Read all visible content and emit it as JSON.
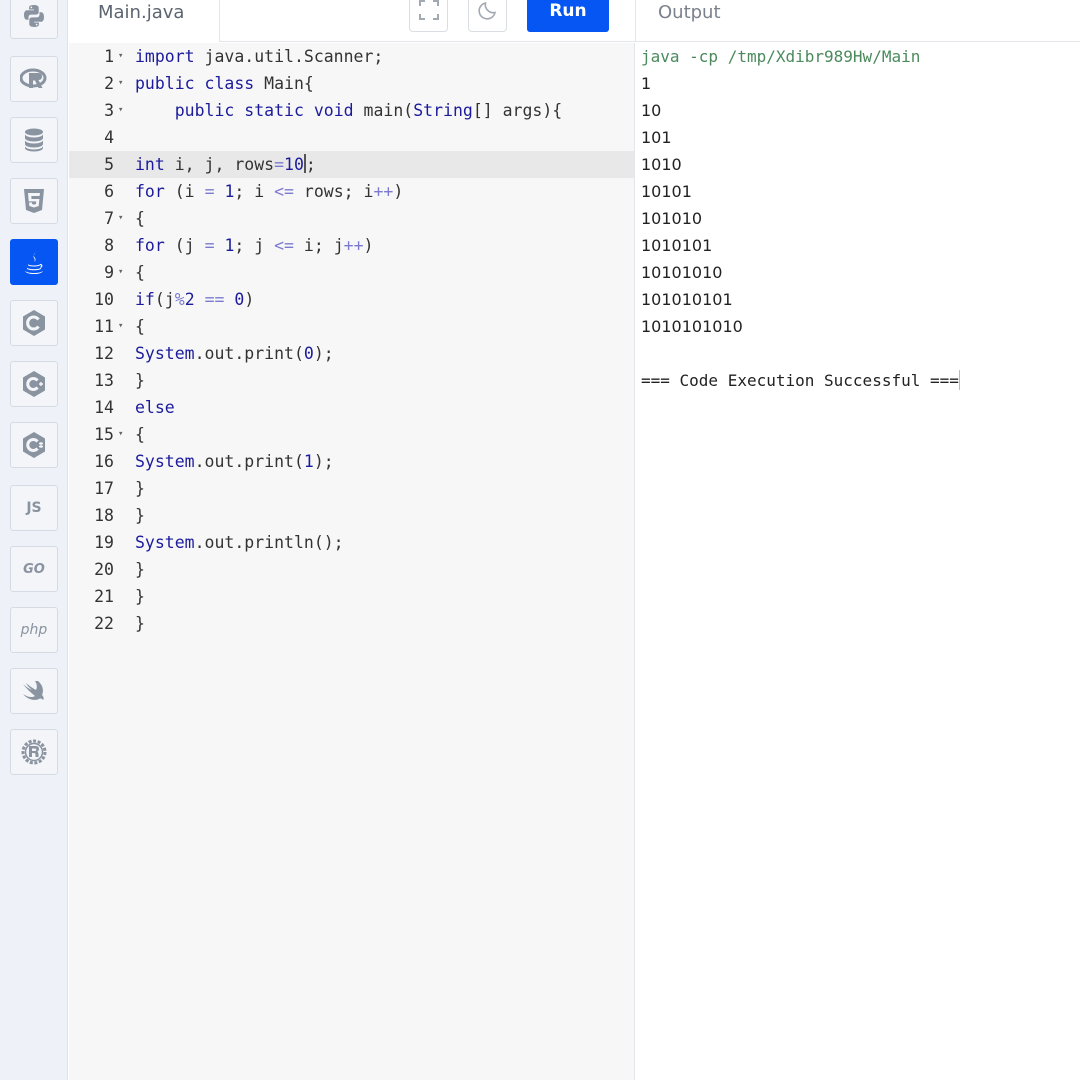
{
  "sidebar": {
    "languages": [
      {
        "name": "python",
        "icon": "python-icon",
        "active": false
      },
      {
        "name": "r",
        "icon": "r-icon",
        "active": false
      },
      {
        "name": "sql",
        "icon": "database-icon",
        "active": false
      },
      {
        "name": "html",
        "icon": "html5-icon",
        "active": false
      },
      {
        "name": "java",
        "icon": "java-icon",
        "active": true
      },
      {
        "name": "c",
        "icon": "c-icon",
        "active": false
      },
      {
        "name": "cpp",
        "icon": "cpp-icon",
        "active": false
      },
      {
        "name": "csharp",
        "icon": "csharp-icon",
        "active": false
      },
      {
        "name": "javascript",
        "icon": "js-icon",
        "label": "JS",
        "active": false
      },
      {
        "name": "go",
        "icon": "go-icon",
        "label": "GO",
        "active": false
      },
      {
        "name": "php",
        "icon": "php-icon",
        "label": "php",
        "active": false
      },
      {
        "name": "swift",
        "icon": "swift-icon",
        "active": false
      },
      {
        "name": "rust",
        "icon": "rust-icon",
        "active": false
      }
    ]
  },
  "toolbar": {
    "file_tab": "Main.java",
    "fullscreen_icon": "fullscreen-icon",
    "theme_icon": "moon-icon",
    "run_label": "Run",
    "output_title": "Output"
  },
  "colors": {
    "accent": "#0556f3",
    "keyword": "#1b1b9c",
    "operator": "#7a7ad0",
    "command": "#4a8a5c"
  },
  "editor": {
    "active_line": 5,
    "lines": [
      {
        "n": "1",
        "fold": true,
        "tokens": [
          [
            "kw",
            "import"
          ],
          [
            "pln",
            " java.util.Scanner;"
          ]
        ]
      },
      {
        "n": "2",
        "fold": true,
        "tokens": [
          [
            "kw",
            "public"
          ],
          [
            "pln",
            " "
          ],
          [
            "kw",
            "class"
          ],
          [
            "pln",
            " Main{"
          ]
        ]
      },
      {
        "n": "3",
        "fold": true,
        "tokens": [
          [
            "pln",
            "    "
          ],
          [
            "kw",
            "public"
          ],
          [
            "pln",
            " "
          ],
          [
            "kw",
            "static"
          ],
          [
            "pln",
            " "
          ],
          [
            "kw",
            "void"
          ],
          [
            "pln",
            " main("
          ],
          [
            "kw",
            "String"
          ],
          [
            "pln",
            "[] args){"
          ]
        ]
      },
      {
        "n": "4",
        "fold": false,
        "tokens": []
      },
      {
        "n": "5",
        "fold": false,
        "tokens": [
          [
            "kw",
            "int"
          ],
          [
            "pln",
            " i, j, rows"
          ],
          [
            "op",
            "="
          ],
          [
            "num",
            "10"
          ],
          [
            "cursor",
            ""
          ],
          [
            "pln",
            ";"
          ]
        ]
      },
      {
        "n": "6",
        "fold": false,
        "tokens": [
          [
            "kw",
            "for"
          ],
          [
            "pln",
            " (i "
          ],
          [
            "op",
            "="
          ],
          [
            "pln",
            " "
          ],
          [
            "num",
            "1"
          ],
          [
            "pln",
            "; i "
          ],
          [
            "op",
            "<="
          ],
          [
            "pln",
            " rows; i"
          ],
          [
            "op",
            "++"
          ],
          [
            "pln",
            ")"
          ]
        ]
      },
      {
        "n": "7",
        "fold": true,
        "tokens": [
          [
            "pln",
            "{"
          ]
        ]
      },
      {
        "n": "8",
        "fold": false,
        "tokens": [
          [
            "kw",
            "for"
          ],
          [
            "pln",
            " (j "
          ],
          [
            "op",
            "="
          ],
          [
            "pln",
            " "
          ],
          [
            "num",
            "1"
          ],
          [
            "pln",
            "; j "
          ],
          [
            "op",
            "<="
          ],
          [
            "pln",
            " i; j"
          ],
          [
            "op",
            "++"
          ],
          [
            "pln",
            ")"
          ]
        ]
      },
      {
        "n": "9",
        "fold": true,
        "tokens": [
          [
            "pln",
            "{"
          ]
        ]
      },
      {
        "n": "10",
        "fold": false,
        "tokens": [
          [
            "kw",
            "if"
          ],
          [
            "pln",
            "(j"
          ],
          [
            "op",
            "%"
          ],
          [
            "num",
            "2"
          ],
          [
            "pln",
            " "
          ],
          [
            "op",
            "=="
          ],
          [
            "pln",
            " "
          ],
          [
            "num",
            "0"
          ],
          [
            "pln",
            ")"
          ]
        ]
      },
      {
        "n": "11",
        "fold": true,
        "tokens": [
          [
            "pln",
            "{"
          ]
        ]
      },
      {
        "n": "12",
        "fold": false,
        "tokens": [
          [
            "kw",
            "System"
          ],
          [
            "pln",
            ".out.print("
          ],
          [
            "num",
            "0"
          ],
          [
            "pln",
            ");"
          ]
        ]
      },
      {
        "n": "13",
        "fold": false,
        "tokens": [
          [
            "pln",
            "}"
          ]
        ]
      },
      {
        "n": "14",
        "fold": false,
        "tokens": [
          [
            "kw",
            "else"
          ]
        ]
      },
      {
        "n": "15",
        "fold": true,
        "tokens": [
          [
            "pln",
            "{"
          ]
        ]
      },
      {
        "n": "16",
        "fold": false,
        "tokens": [
          [
            "kw",
            "System"
          ],
          [
            "pln",
            ".out.print("
          ],
          [
            "num",
            "1"
          ],
          [
            "pln",
            ");"
          ]
        ]
      },
      {
        "n": "17",
        "fold": false,
        "tokens": [
          [
            "pln",
            "}"
          ]
        ]
      },
      {
        "n": "18",
        "fold": false,
        "tokens": [
          [
            "pln",
            "}"
          ]
        ]
      },
      {
        "n": "19",
        "fold": false,
        "tokens": [
          [
            "kw",
            "System"
          ],
          [
            "pln",
            ".out.println();"
          ]
        ]
      },
      {
        "n": "20",
        "fold": false,
        "tokens": [
          [
            "pln",
            "}"
          ]
        ]
      },
      {
        "n": "21",
        "fold": false,
        "tokens": [
          [
            "pln",
            "}"
          ]
        ]
      },
      {
        "n": "22",
        "fold": false,
        "tokens": [
          [
            "pln",
            "}"
          ]
        ]
      }
    ]
  },
  "output": {
    "command": "java -cp /tmp/Xdibr989Hw/Main",
    "results": [
      "1",
      "10",
      "101",
      "1010",
      "10101",
      "101010",
      "1010101",
      "10101010",
      "101010101",
      "1010101010"
    ],
    "status": "=== Code Execution Successful ==="
  }
}
